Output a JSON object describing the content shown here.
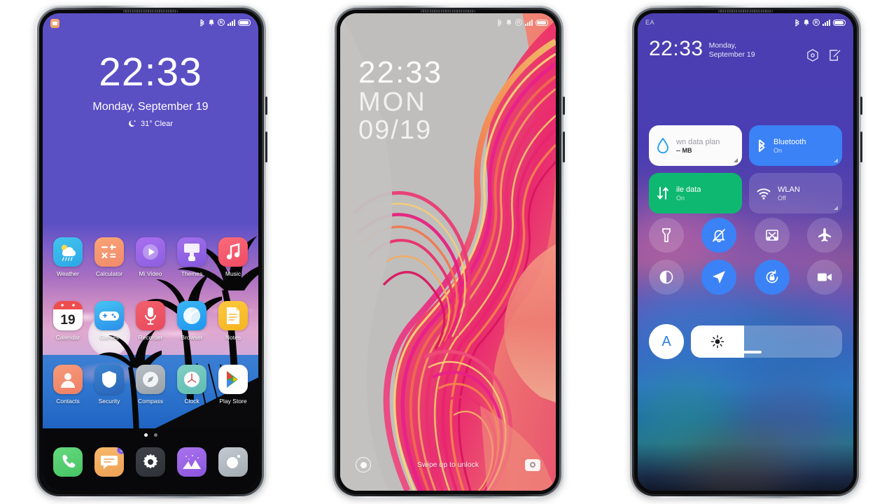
{
  "phone1": {
    "name": "home-screen-phone",
    "statusbar": {
      "icons": [
        "bluetooth-icon",
        "alarm-icon",
        "vibrate-icon",
        "signal-icon",
        "battery-icon"
      ]
    },
    "notification_icon": "message-notification-icon",
    "lock": {
      "time": "22:33",
      "date": "Monday, September 19",
      "weather": "31° Clear",
      "weather_icon": "moon-icon"
    },
    "apps_row1": [
      {
        "label": "Weather",
        "icon": "weather-icon"
      },
      {
        "label": "Calculator",
        "icon": "calculator-icon"
      },
      {
        "label": "Mi Video",
        "icon": "mi-video-icon"
      },
      {
        "label": "Themes",
        "icon": "themes-icon"
      },
      {
        "label": "Music",
        "icon": "music-icon"
      }
    ],
    "apps_row2": [
      {
        "label": "Calendar",
        "icon": "calendar-icon",
        "day": "19"
      },
      {
        "label": "Games",
        "icon": "games-icon"
      },
      {
        "label": "Recorder",
        "icon": "recorder-icon"
      },
      {
        "label": "Browser",
        "icon": "browser-icon"
      },
      {
        "label": "Notes",
        "icon": "notes-icon"
      }
    ],
    "apps_row3": [
      {
        "label": "Contacts",
        "icon": "contacts-icon"
      },
      {
        "label": "Security",
        "icon": "security-icon"
      },
      {
        "label": "Compass",
        "icon": "compass-icon"
      },
      {
        "label": "Clock",
        "icon": "clock-icon"
      },
      {
        "label": "Play Store",
        "icon": "play-store-icon"
      }
    ],
    "dock": [
      {
        "label": "Phone",
        "icon": "phone-icon"
      },
      {
        "label": "Messages",
        "icon": "messages-icon",
        "badge": "3"
      },
      {
        "label": "Settings",
        "icon": "settings-gear-icon"
      },
      {
        "label": "Gallery",
        "icon": "gallery-icon"
      },
      {
        "label": "Camera",
        "icon": "camera-icon"
      }
    ],
    "page_indicator": {
      "pages": 2,
      "active": 1
    }
  },
  "phone2": {
    "name": "lockscreen-phone",
    "statusbar": {
      "icons": [
        "bluetooth-icon",
        "alarm-icon",
        "vibrate-icon",
        "signal-icon",
        "battery-icon"
      ]
    },
    "clock": {
      "time": "22:33",
      "weekday": "MON",
      "date": "09/19"
    },
    "bottom": {
      "hint": "Swipe up to unlock",
      "left_icon": "fingerprint-icon",
      "right_icon": "camera-icon"
    }
  },
  "phone3": {
    "name": "control-center-phone",
    "statusbar": {
      "carrier": "EA",
      "icons": [
        "bluetooth-icon",
        "alarm-icon",
        "vibrate-icon",
        "signal-icon",
        "battery-icon"
      ]
    },
    "header": {
      "time": "22:33",
      "date": "Monday, September 19",
      "settings_icon": "hexagon-settings-icon",
      "edit_icon": "edit-icon"
    },
    "tiles": [
      {
        "title": "wn data plan",
        "subtitle": "-- MB",
        "icon": "data-drop-icon",
        "state": "light"
      },
      {
        "title": "Bluetooth",
        "subtitle": "On",
        "icon": "bluetooth-icon",
        "state": "blue"
      },
      {
        "title": "ile data",
        "subtitle": "On",
        "icon": "mobile-data-icon",
        "state": "green"
      },
      {
        "title": "WLAN",
        "subtitle": "Off",
        "icon": "wifi-icon",
        "state": "dim"
      }
    ],
    "toggles_row1": [
      {
        "name": "flashlight-icon",
        "on": false
      },
      {
        "name": "silent-bell-icon",
        "on": true
      },
      {
        "name": "screenshot-icon",
        "on": false
      },
      {
        "name": "airplane-icon",
        "on": false
      }
    ],
    "toggles_row2": [
      {
        "name": "dark-mode-icon",
        "on": false
      },
      {
        "name": "location-icon",
        "on": true
      },
      {
        "name": "rotation-lock-icon",
        "on": true
      },
      {
        "name": "screen-record-icon",
        "on": false
      }
    ],
    "brightness": {
      "auto_label": "A",
      "icon": "brightness-sun-icon",
      "value_percent": 35
    }
  },
  "colors": {
    "phone1_bg": "#5b4fc4",
    "phone2_bg": "#c0bebc",
    "phone3_bg": "#4a3fb0",
    "accent_blue": "#3b82f6",
    "accent_green": "#0fb871",
    "tile_light": "#fbfbfc"
  }
}
